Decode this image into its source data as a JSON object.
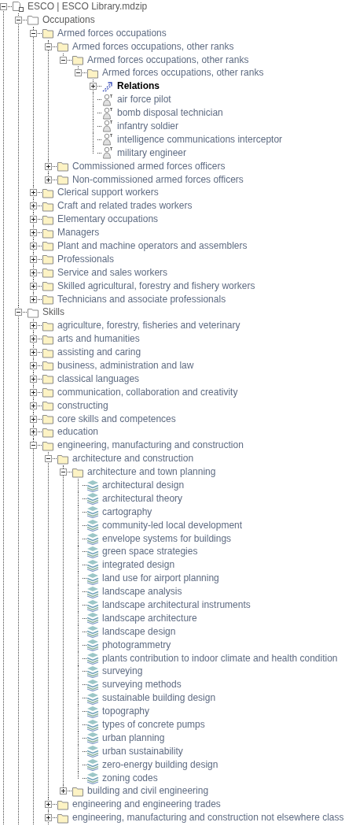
{
  "tree": [
    {
      "kind": "model",
      "label": "ESCO | ESCO Library.mdzip",
      "expanded": true,
      "children": [
        {
          "kind": "package",
          "label": "Occupations",
          "expanded": true,
          "children": [
            {
              "kind": "folder",
              "label": "Armed forces occupations",
              "expanded": true,
              "children": [
                {
                  "kind": "folder",
                  "label": "Armed forces occupations, other ranks",
                  "expanded": true,
                  "children": [
                    {
                      "kind": "folder",
                      "label": "Armed forces occupations, other ranks",
                      "expanded": true,
                      "children": [
                        {
                          "kind": "folder",
                          "label": "Armed forces occupations, other ranks",
                          "expanded": true,
                          "children": [
                            {
                              "kind": "relations",
                              "label": "Relations",
                              "expanded": false
                            },
                            {
                              "kind": "actor",
                              "label": "air force pilot"
                            },
                            {
                              "kind": "actor",
                              "label": "bomb disposal technician"
                            },
                            {
                              "kind": "actor",
                              "label": "infantry soldier"
                            },
                            {
                              "kind": "actor",
                              "label": "intelligence communications interceptor"
                            },
                            {
                              "kind": "actor",
                              "label": "military engineer"
                            }
                          ]
                        }
                      ]
                    }
                  ]
                },
                {
                  "kind": "folder",
                  "label": "Commissioned armed forces officers",
                  "expanded": false
                },
                {
                  "kind": "folder",
                  "label": "Non-commissioned armed forces officers",
                  "expanded": false
                }
              ]
            },
            {
              "kind": "folder",
              "label": "Clerical support workers",
              "expanded": false
            },
            {
              "kind": "folder",
              "label": "Craft and related trades workers",
              "expanded": false
            },
            {
              "kind": "folder",
              "label": "Elementary occupations",
              "expanded": false
            },
            {
              "kind": "folder",
              "label": "Managers",
              "expanded": false
            },
            {
              "kind": "folder",
              "label": "Plant and machine operators and assemblers",
              "expanded": false
            },
            {
              "kind": "folder",
              "label": "Professionals",
              "expanded": false
            },
            {
              "kind": "folder",
              "label": "Service and sales workers",
              "expanded": false
            },
            {
              "kind": "folder",
              "label": "Skilled agricultural, forestry and fishery workers",
              "expanded": false
            },
            {
              "kind": "folder",
              "label": "Technicians and associate professionals",
              "expanded": false
            }
          ]
        },
        {
          "kind": "package",
          "label": "Skills",
          "expanded": true,
          "children": [
            {
              "kind": "folder",
              "label": "agriculture, forestry, fisheries and veterinary",
              "expanded": false
            },
            {
              "kind": "folder",
              "label": "arts and humanities",
              "expanded": false
            },
            {
              "kind": "folder",
              "label": "assisting and caring",
              "expanded": false
            },
            {
              "kind": "folder",
              "label": "business, administration and law",
              "expanded": false
            },
            {
              "kind": "folder",
              "label": "classical languages",
              "expanded": false
            },
            {
              "kind": "folder",
              "label": "communication, collaboration and creativity",
              "expanded": false
            },
            {
              "kind": "folder",
              "label": "constructing",
              "expanded": false
            },
            {
              "kind": "folder",
              "label": "core skills and competences",
              "expanded": false
            },
            {
              "kind": "folder",
              "label": "education",
              "expanded": false
            },
            {
              "kind": "folder",
              "label": "engineering, manufacturing and construction",
              "expanded": true,
              "children": [
                {
                  "kind": "folder",
                  "label": "architecture and construction",
                  "expanded": true,
                  "children": [
                    {
                      "kind": "folder",
                      "label": "architecture and town planning",
                      "expanded": true,
                      "children": [
                        {
                          "kind": "skill",
                          "label": "architectural design"
                        },
                        {
                          "kind": "skill",
                          "label": "architectural theory"
                        },
                        {
                          "kind": "skill",
                          "label": "cartography"
                        },
                        {
                          "kind": "skill",
                          "label": "community-led local development"
                        },
                        {
                          "kind": "skill",
                          "label": "envelope systems for buildings"
                        },
                        {
                          "kind": "skill",
                          "label": "green space strategies"
                        },
                        {
                          "kind": "skill",
                          "label": "integrated design"
                        },
                        {
                          "kind": "skill",
                          "label": "land use for airport planning"
                        },
                        {
                          "kind": "skill",
                          "label": "landscape analysis"
                        },
                        {
                          "kind": "skill",
                          "label": "landscape architectural instruments"
                        },
                        {
                          "kind": "skill",
                          "label": "landscape architecture"
                        },
                        {
                          "kind": "skill",
                          "label": "landscape design"
                        },
                        {
                          "kind": "skill",
                          "label": "photogrammetry"
                        },
                        {
                          "kind": "skill",
                          "label": "plants contribution to indoor climate and health condition"
                        },
                        {
                          "kind": "skill",
                          "label": "surveying"
                        },
                        {
                          "kind": "skill",
                          "label": "surveying methods"
                        },
                        {
                          "kind": "skill",
                          "label": "sustainable building design"
                        },
                        {
                          "kind": "skill",
                          "label": "topography"
                        },
                        {
                          "kind": "skill",
                          "label": "types of concrete pumps"
                        },
                        {
                          "kind": "skill",
                          "label": "urban planning"
                        },
                        {
                          "kind": "skill",
                          "label": "urban sustainability"
                        },
                        {
                          "kind": "skill",
                          "label": "zero-energy building design"
                        },
                        {
                          "kind": "skill",
                          "label": "zoning codes"
                        }
                      ]
                    },
                    {
                      "kind": "folder",
                      "label": "building and civil engineering",
                      "expanded": false
                    }
                  ]
                },
                {
                  "kind": "folder",
                  "label": "engineering and engineering trades",
                  "expanded": false
                },
                {
                  "kind": "folder",
                  "label": "engineering, manufacturing and construction not elsewhere class",
                  "expanded": false
                }
              ]
            }
          ]
        }
      ]
    }
  ]
}
